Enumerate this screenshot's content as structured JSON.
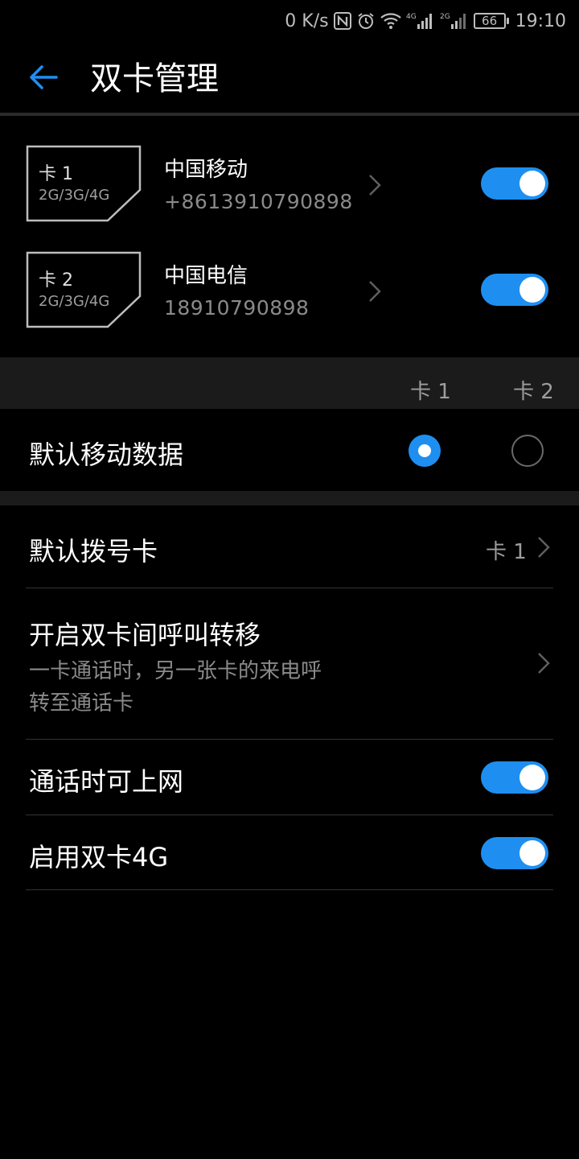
{
  "status_bar": {
    "speed": "0 K/s",
    "battery": "66",
    "time": "19:10",
    "icons": [
      "nfc-icon",
      "alarm-icon",
      "wifi-icon",
      "signal-4g-icon",
      "signal-2g-icon",
      "battery-icon"
    ]
  },
  "header": {
    "title": "双卡管理",
    "back_icon": "back-arrow-icon"
  },
  "sims": [
    {
      "card_label": "卡 1",
      "network": "2G/3G/4G",
      "carrier": "中国移动",
      "number": "+8613910790898",
      "enabled": true
    },
    {
      "card_label": "卡 2",
      "network": "2G/3G/4G",
      "carrier": "中国电信",
      "number": "18910790898",
      "enabled": true
    }
  ],
  "default_data": {
    "col1": "卡 1",
    "col2": "卡 2",
    "label": "默认移动数据",
    "selected": "卡 1"
  },
  "settings": {
    "default_dial_label": "默认拨号卡",
    "default_dial_value": "卡 1",
    "forward_label": "开启双卡间呼叫转移",
    "forward_desc_line1": "一卡通话时，另一张卡的来电呼",
    "forward_desc_line2": "转至通话卡",
    "internet_in_call_label": "通话时可上网",
    "internet_in_call_on": true,
    "dual_4g_label": "启用双卡4G",
    "dual_4g_on": true
  },
  "colors": {
    "accent": "#1e8ff1",
    "background": "#000000",
    "secondary_text": "#8a8a8a"
  }
}
